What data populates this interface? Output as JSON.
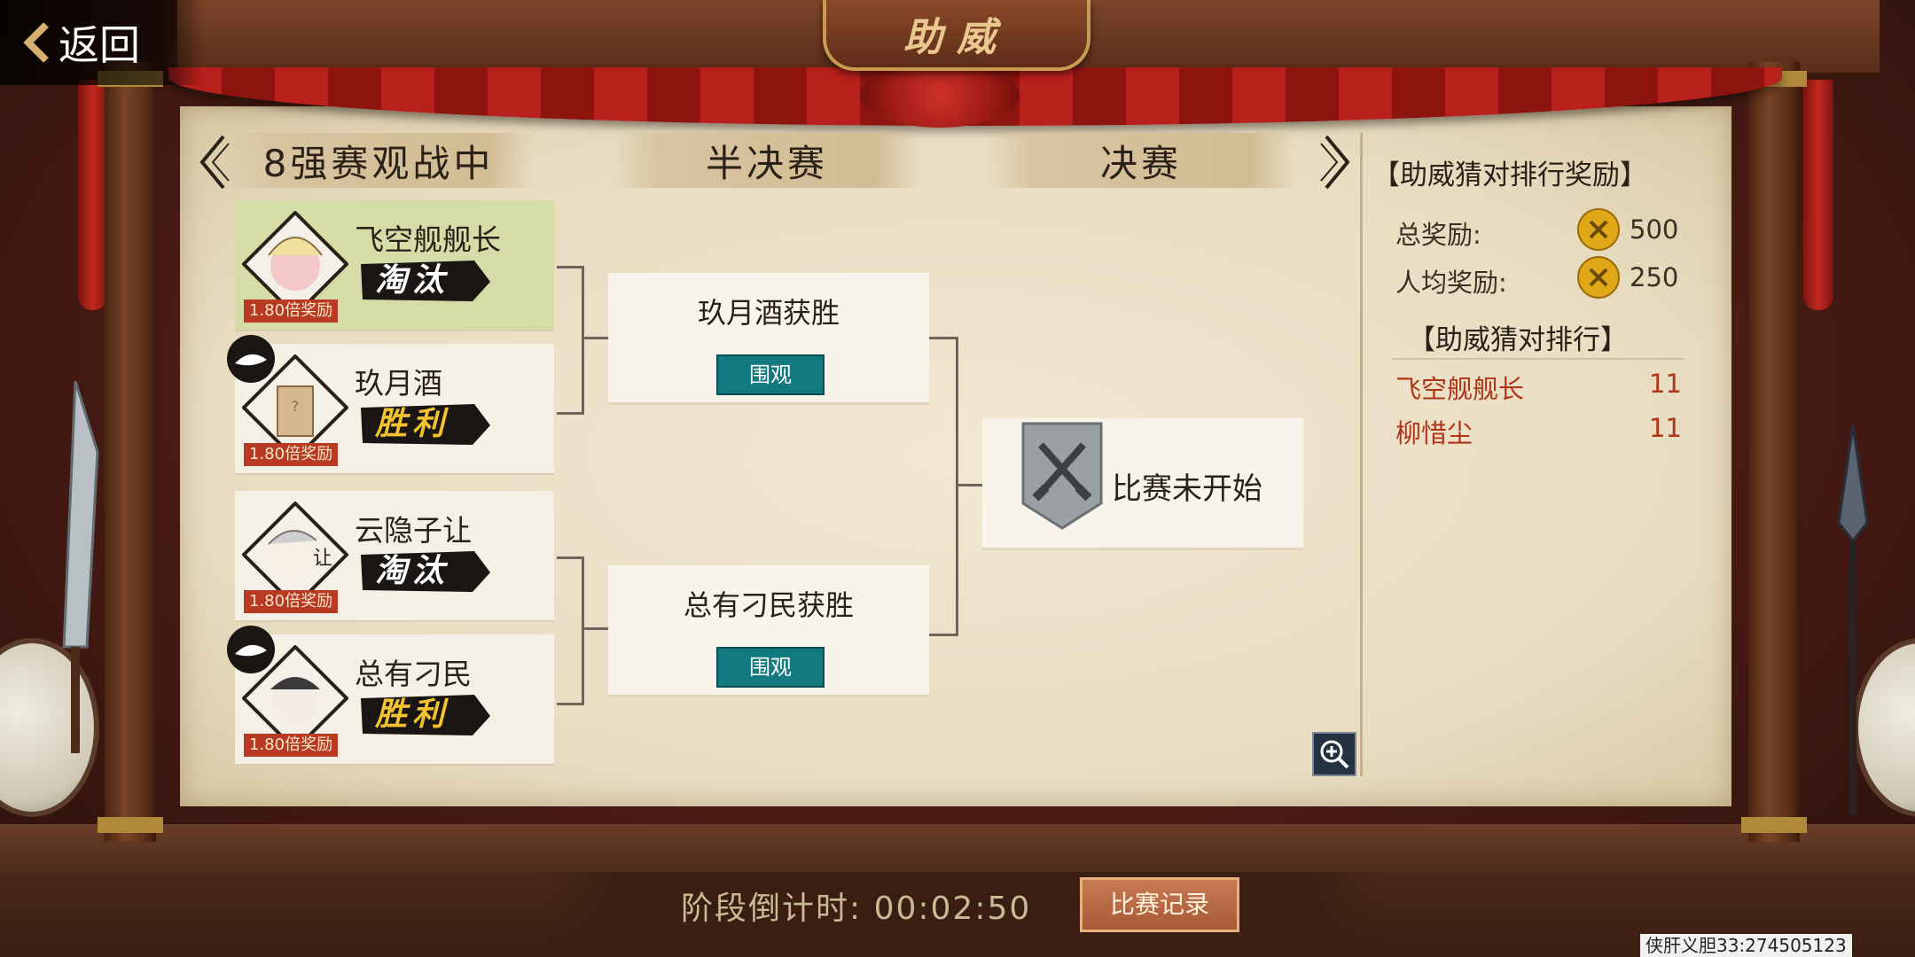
{
  "header": {
    "back_label": "返回",
    "title": "助威"
  },
  "rounds": [
    "8强赛观战中",
    "半决赛",
    "决赛"
  ],
  "players": [
    {
      "name": "飞空舰舰长",
      "result": "淘汰",
      "result_color": "#ffffff",
      "bonus": "1.80倍奖励"
    },
    {
      "name": "玖月酒",
      "result": "胜利",
      "result_color": "#f2c230",
      "bonus": "1.80倍奖励"
    },
    {
      "name": "云隐子让",
      "result": "淘汰",
      "result_color": "#ffffff",
      "bonus": "1.80倍奖励"
    },
    {
      "name": "总有刁民",
      "result": "胜利",
      "result_color": "#f2c230",
      "bonus": "1.80倍奖励"
    }
  ],
  "avatar_mark": "让",
  "semifinals": [
    {
      "winner_text": "玖月酒获胜",
      "watch_label": "围观"
    },
    {
      "winner_text": "总有刁民获胜",
      "watch_label": "围观"
    }
  ],
  "final": {
    "status": "比赛未开始",
    "icon": "crossed-swords-shield-icon"
  },
  "reward_panel": {
    "title": "【助威猜对排行奖励】",
    "total_label": "总奖励:",
    "total_amount": "500",
    "per_label": "人均奖励:",
    "per_amount": "250",
    "coin_icon": "gold-coin-icon"
  },
  "ranking": {
    "title": "【助威猜对排行】",
    "entries": [
      {
        "name": "飞空舰舰长",
        "score": "11"
      },
      {
        "name": "柳惜尘",
        "score": "11"
      }
    ]
  },
  "footer": {
    "countdown": "阶段倒计时: 00:02:50",
    "record_label": "比赛记录",
    "watermark": "侠肝义胆33:274505123"
  },
  "colors": {
    "accent_teal": "#137a80",
    "ranking_red": "#b03418",
    "win_gold": "#f2c230",
    "bonus_red": "#b83a22"
  }
}
